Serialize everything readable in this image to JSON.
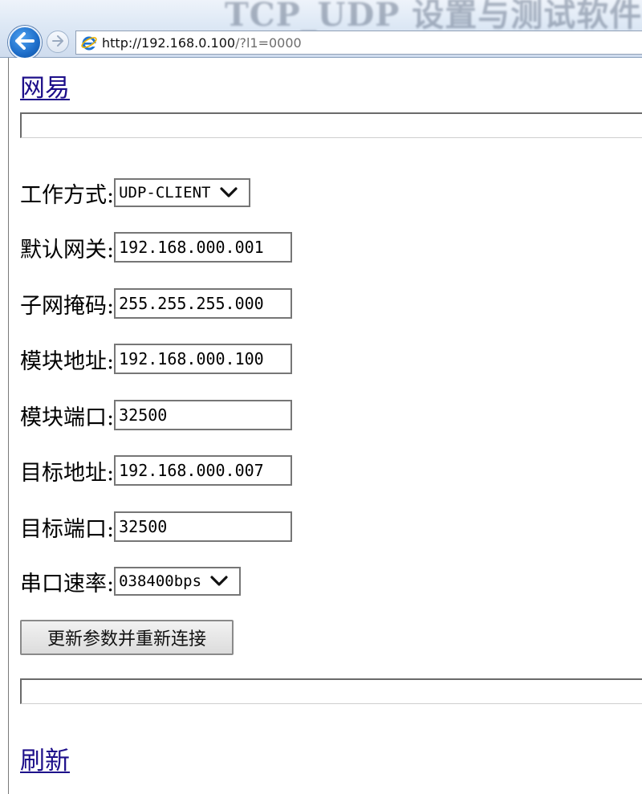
{
  "window": {
    "title": "TCP_UDP 设置与测试软件"
  },
  "browser": {
    "url_host": "http://192.168.0.100",
    "url_rest": "/?l1=0000"
  },
  "page": {
    "top_link": "网易",
    "bottom_link": "刷新",
    "fields": {
      "work_mode": {
        "label": "工作方式:",
        "value": "UDP-CLIENT"
      },
      "gateway": {
        "label": "默认网关:",
        "value": "192.168.000.001"
      },
      "subnet": {
        "label": "子网掩码:",
        "value": "255.255.255.000"
      },
      "module_addr": {
        "label": "模块地址:",
        "value": "192.168.000.100"
      },
      "module_port": {
        "label": "模块端口:",
        "value": "32500"
      },
      "target_addr": {
        "label": "目标地址:",
        "value": "192.168.000.007"
      },
      "target_port": {
        "label": "目标端口:",
        "value": "32500"
      },
      "baud": {
        "label": "串口速率:",
        "value": "038400bps"
      }
    },
    "submit_label": "更新参数并重新连接"
  }
}
